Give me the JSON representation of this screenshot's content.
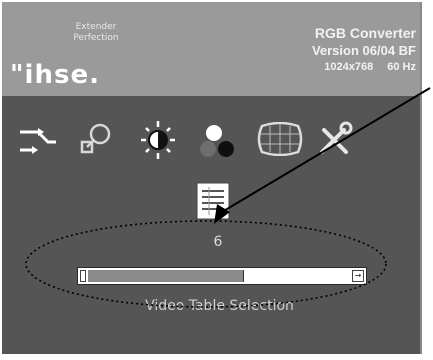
{
  "header": {
    "tagline": "Extender\nPerfection",
    "logo": "\"ihse.",
    "product": "RGB Converter",
    "version": "Version 06/04 BF",
    "resolution": "1024x768",
    "refresh": "60 Hz"
  },
  "menu": {
    "icons": [
      "input-arrows-icon",
      "zoom-icon",
      "brightness-icon",
      "color-dots-icon",
      "geometry-icon",
      "tools-icon"
    ]
  },
  "selection": {
    "icon": "video-table-icon",
    "value": "6",
    "slider_level": 0.59,
    "caption": "Video Table Selection"
  },
  "annotation": {
    "type": "dotted-ellipse-with-arrow"
  }
}
